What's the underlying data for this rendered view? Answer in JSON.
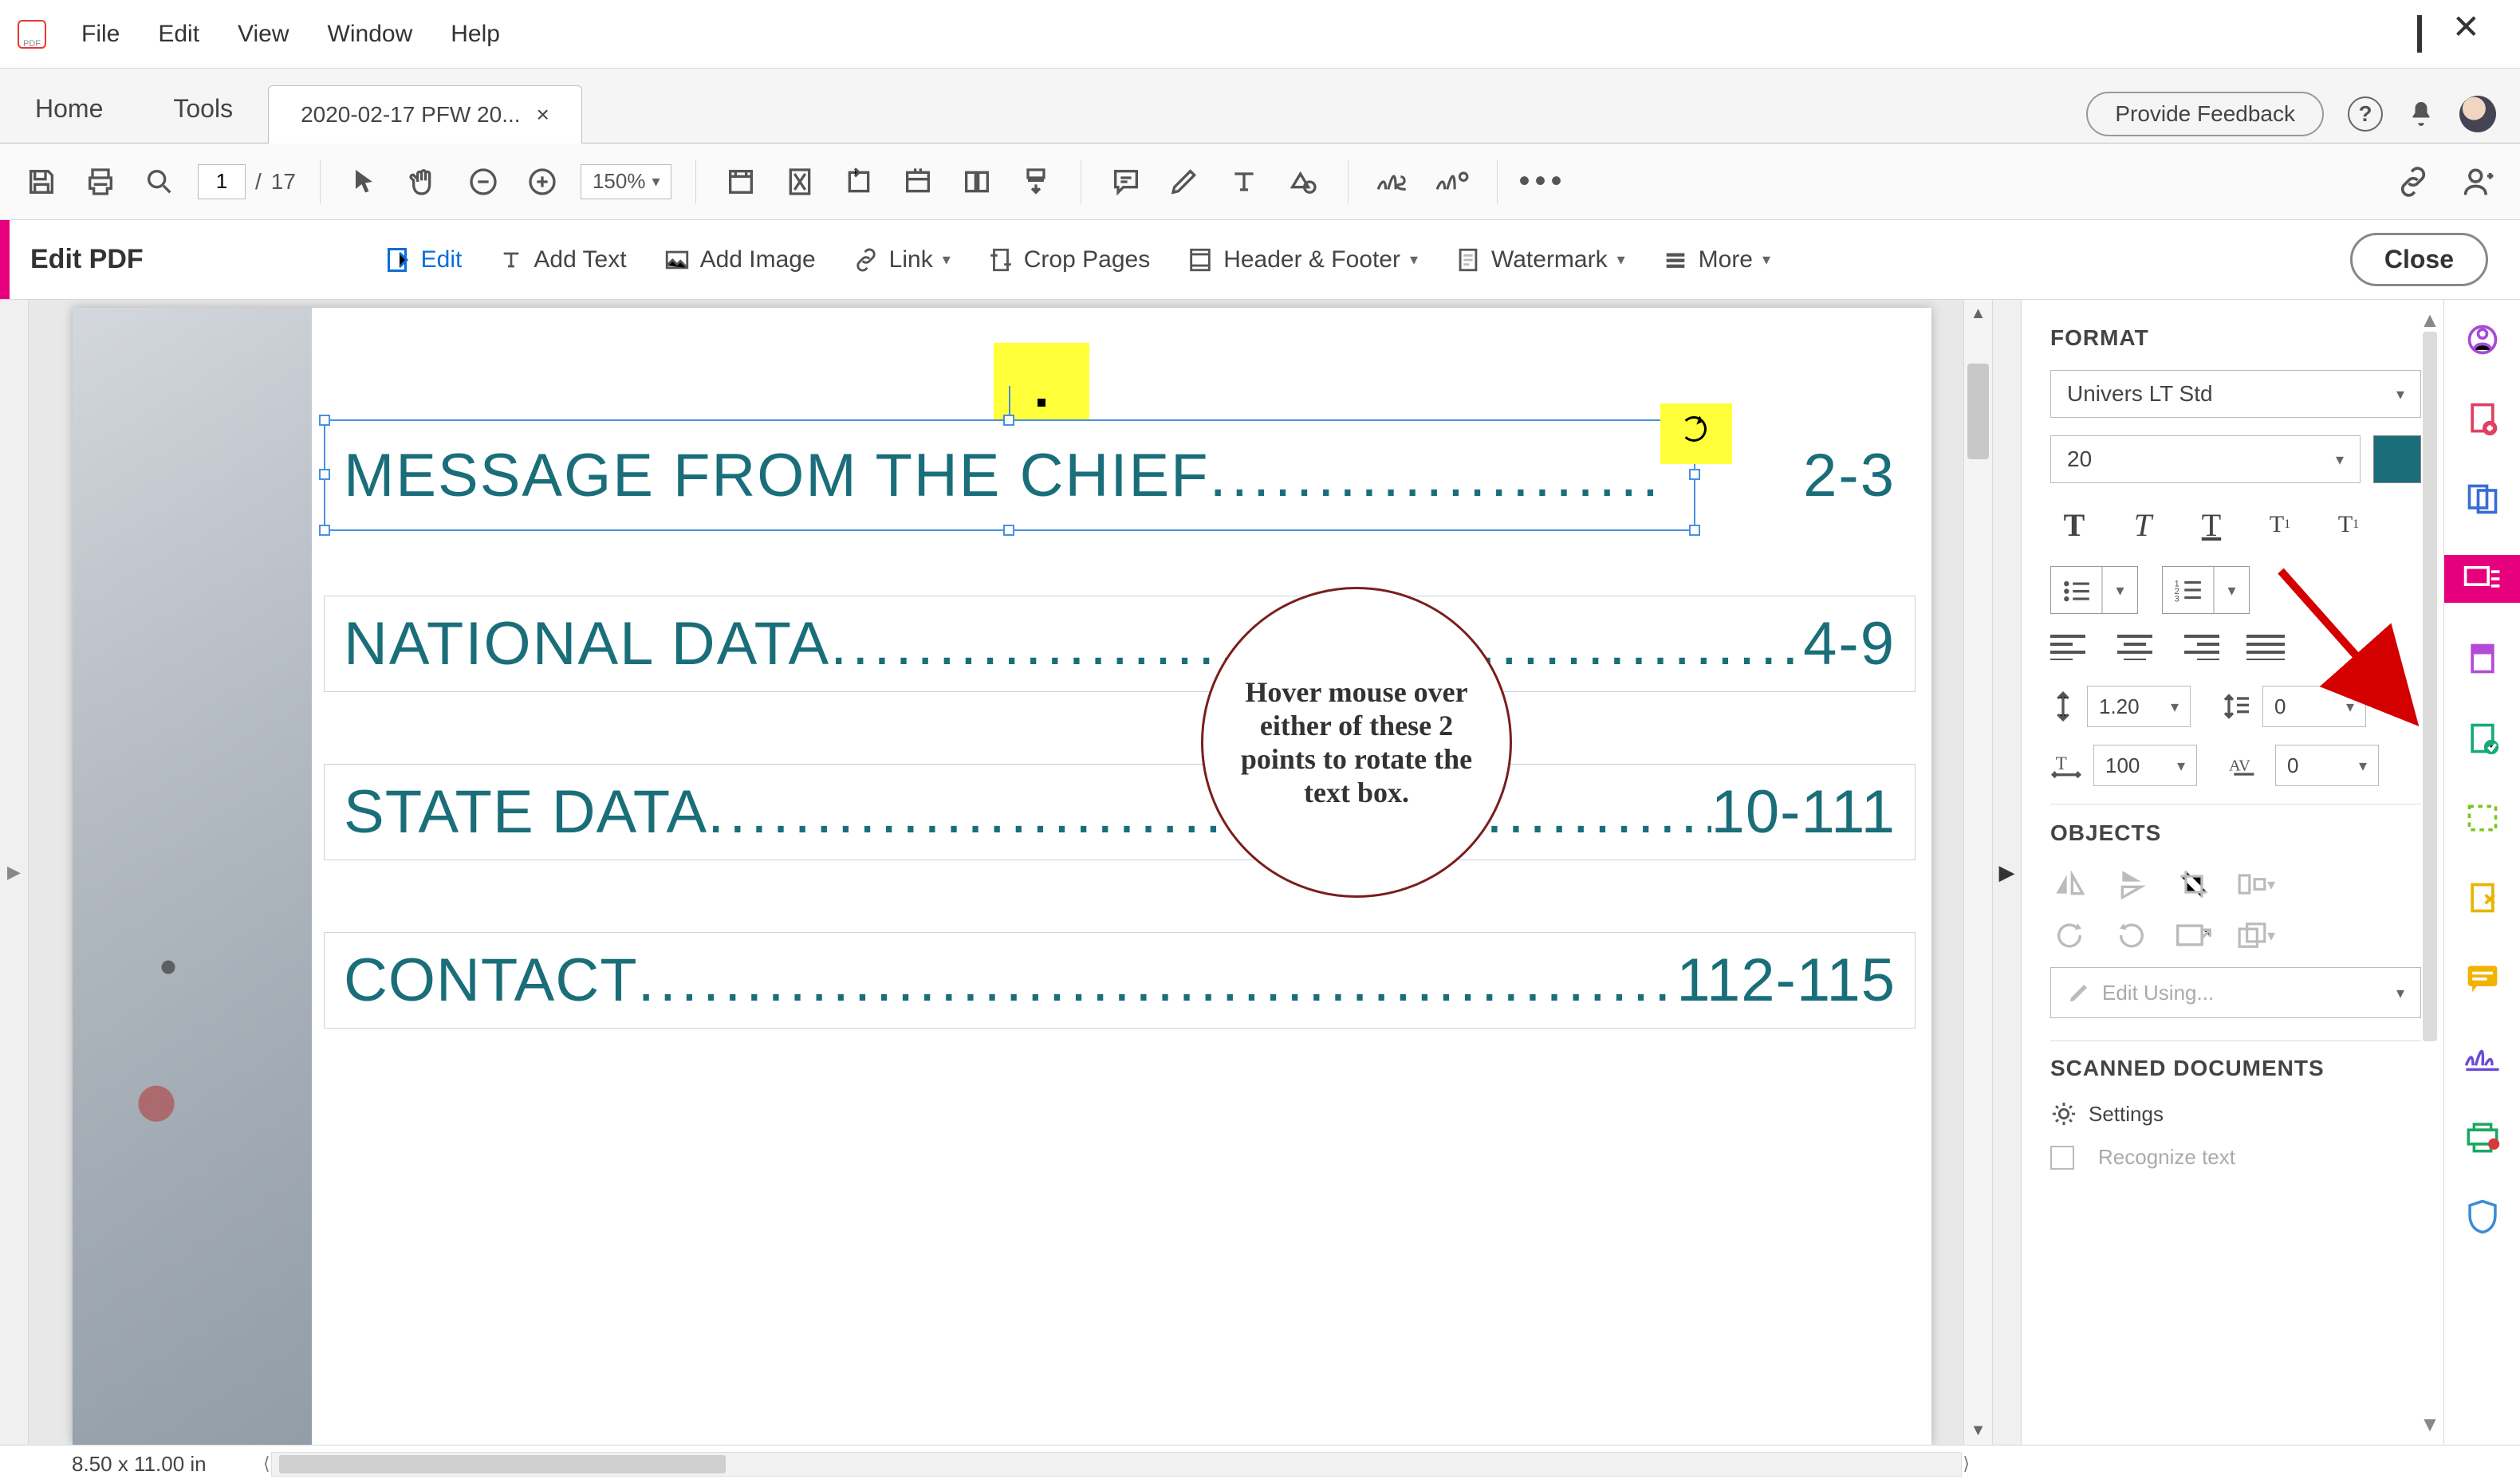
{
  "menu": {
    "file": "File",
    "edit": "Edit",
    "view": "View",
    "window": "Window",
    "help": "Help"
  },
  "nav_tabs": {
    "home": "Home",
    "tools": "Tools"
  },
  "doc_tab": {
    "title": "2020-02-17 PFW 20...",
    "close": "×"
  },
  "header_right": {
    "feedback": "Provide Feedback",
    "help": "?"
  },
  "cmdbar": {
    "page_current": "1",
    "page_sep": "/",
    "page_total": "17",
    "zoom": "150%",
    "more": "•••"
  },
  "subbar": {
    "title": "Edit PDF",
    "edit": "Edit",
    "add_text": "Add Text",
    "add_image": "Add Image",
    "link": "Link",
    "crop": "Crop Pages",
    "header_footer": "Header & Footer",
    "watermark": "Watermark",
    "more": "More",
    "close": "Close"
  },
  "toc": {
    "row1": {
      "label": "MESSAGE FROM THE CHIEF",
      "page": "2-3"
    },
    "row2": {
      "label": "NATIONAL DATA",
      "page": "4-9"
    },
    "row3": {
      "label": "STATE DATA ",
      "page": "10-111"
    },
    "row4": {
      "label": "CONTACT",
      "page": "112-115"
    }
  },
  "callout": "Hover mouse over either of these 2 points to rotate the text box.",
  "format": {
    "heading": "FORMAT",
    "font": "Univers LT Std",
    "size": "20",
    "line_spacing": "1.20",
    "para_spacing": "0",
    "hscale": "100",
    "tracking": "0",
    "objects_heading": "OBJECTS",
    "edit_using": "Edit Using...",
    "scanned_heading": "SCANNED DOCUMENTS",
    "settings": "Settings",
    "recognize": "Recognize text"
  },
  "status": {
    "page_size": "8.50 x 11.00 in"
  },
  "colors": {
    "accent": "#e6007e",
    "teal": "#1a6e7a"
  }
}
